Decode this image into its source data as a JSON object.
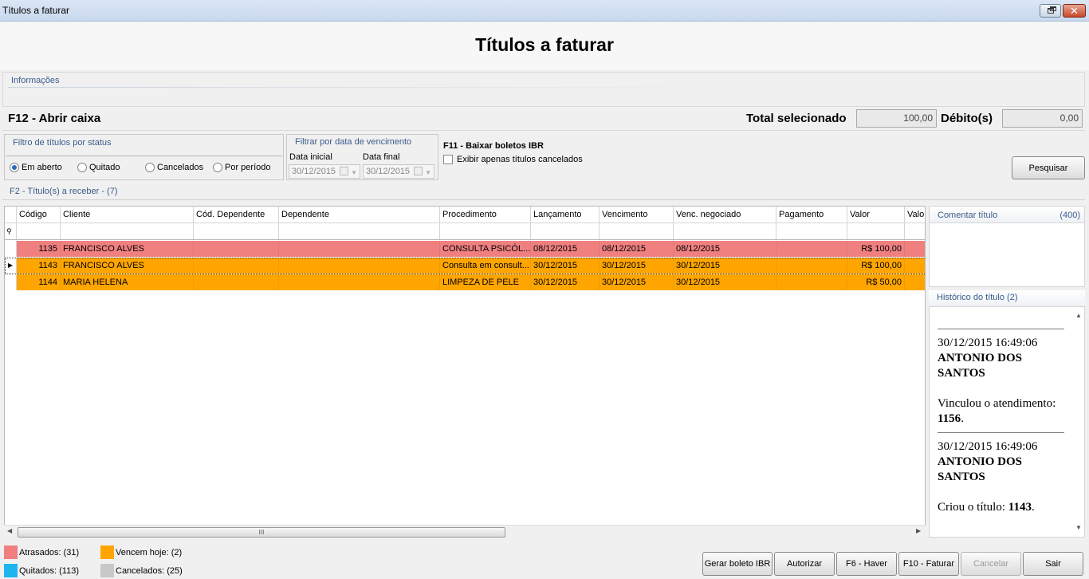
{
  "window": {
    "title": "Títulos a faturar",
    "restore_icon": "restore-icon",
    "close_icon": "close-icon"
  },
  "header": {
    "title": "Títulos a faturar"
  },
  "info": {
    "title": "Informações"
  },
  "caixa": {
    "label": "F12 - Abrir caixa",
    "total_label": "Total selecionado",
    "total_value": "100,00",
    "debito_label": "Débito(s)",
    "debito_value": "0,00"
  },
  "status_filter": {
    "title": "Filtro de títulos por status",
    "options": [
      {
        "label": "Em aberto",
        "selected": true
      },
      {
        "label": "Quitado",
        "selected": false
      },
      {
        "label": "Cancelados",
        "selected": false
      },
      {
        "label": "Por período",
        "selected": false
      }
    ]
  },
  "date_filter": {
    "title": "Filtrar por data de vencimento",
    "start_label": "Data inicial",
    "start_value": "30/12/2015",
    "end_label": "Data final",
    "end_value": "30/12/2015"
  },
  "ibr": {
    "label": "F11 - Baixar boletos IBR",
    "checkbox_label": "Exibir apenas títulos cancelados",
    "checked": false
  },
  "search_button": "Pesquisar",
  "grid": {
    "title": "F2 - Título(s) a receber - (7)",
    "columns": [
      "Código",
      "Cliente",
      "Cód. Dependente",
      "Dependente",
      "Procedimento",
      "Lançamento",
      "Vencimento",
      "Venc. negociado",
      "Pagamento",
      "Valor",
      "Valor"
    ],
    "rows": [
      {
        "codigo": "1135",
        "cliente": "FRANCISCO ALVES",
        "cod_dep": "",
        "dependente": "",
        "procedimento": "CONSULTA PSICÓL...",
        "lancamento": "08/12/2015",
        "vencimento": "08/12/2015",
        "venc_neg": "08/12/2015",
        "pagamento": "",
        "valor": "R$ 100,00",
        "status": "atrasado",
        "current": false
      },
      {
        "codigo": "1143",
        "cliente": "FRANCISCO ALVES",
        "cod_dep": "",
        "dependente": "",
        "procedimento": "Consulta em consult...",
        "lancamento": "30/12/2015",
        "vencimento": "30/12/2015",
        "venc_neg": "30/12/2015",
        "pagamento": "",
        "valor": "R$ 100,00",
        "status": "hoje",
        "current": true
      },
      {
        "codigo": "1144",
        "cliente": "MARIA HELENA",
        "cod_dep": "",
        "dependente": "",
        "procedimento": "LIMPEZA DE PELE",
        "lancamento": "30/12/2015",
        "vencimento": "30/12/2015",
        "venc_neg": "30/12/2015",
        "pagamento": "",
        "valor": "R$ 50,00",
        "status": "hoje",
        "current": false
      }
    ],
    "scroll_grip": "III"
  },
  "comment": {
    "title": "Comentar título",
    "count": "(400)"
  },
  "history": {
    "title": "Histórico do título (2)",
    "entries": [
      {
        "datetime": "30/12/2015 16:49:06",
        "user": "ANTONIO DOS SANTOS",
        "text": "Vinculou o atendimento:",
        "ref": "1156",
        "suffix": "."
      },
      {
        "datetime": "30/12/2015 16:49:06",
        "user": "ANTONIO DOS SANTOS",
        "text": "Criou o título:",
        "ref": "1143",
        "suffix": "."
      }
    ]
  },
  "legend": {
    "atrasados": "Atrasados: (31)",
    "vencem_hoje": "Vencem hoje: (2)",
    "quitados": "Quitados: (113)",
    "cancelados": "Cancelados: (25)"
  },
  "colors": {
    "atrasado": "#f08080",
    "hoje": "#ffa500",
    "quitado": "#1eb4f0",
    "cancelado": "#c8c8c8"
  },
  "buttons": {
    "gerar_boleto": "Gerar boleto IBR",
    "autorizar": "Autorizar",
    "haver": "F6 - Haver",
    "faturar": "F10 - Faturar",
    "cancelar": "Cancelar",
    "sair": "Sair"
  }
}
